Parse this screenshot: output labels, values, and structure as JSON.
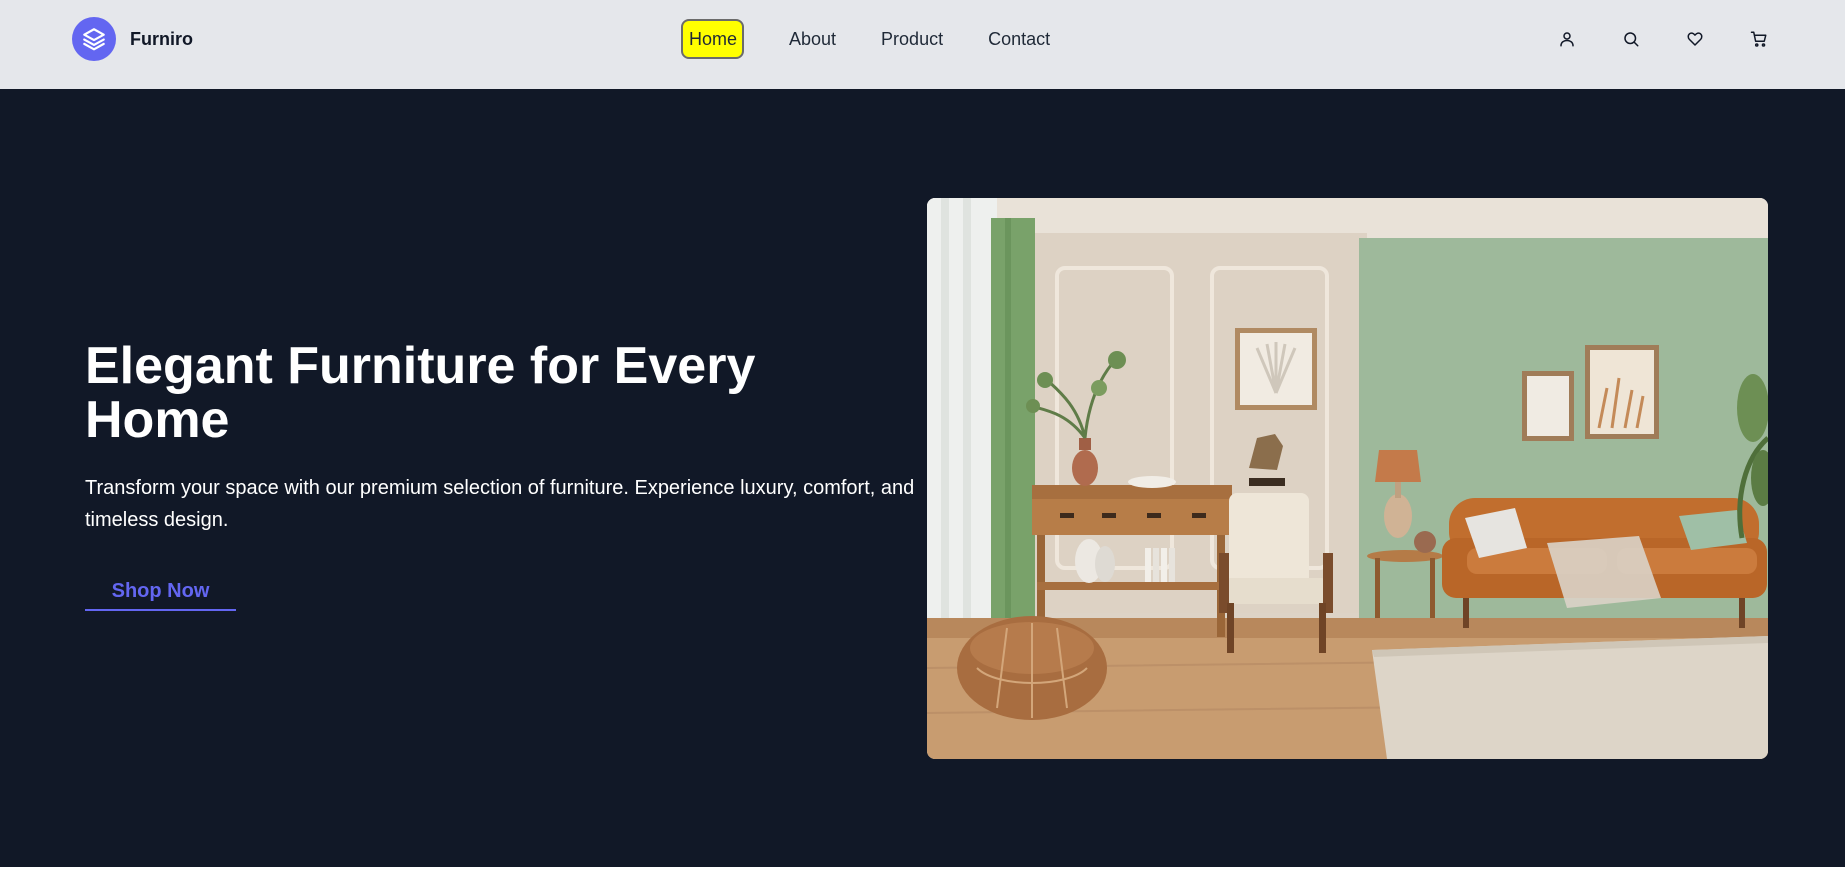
{
  "brand": {
    "name": "Furniro",
    "logo_icon": "layers-icon",
    "accent": "#6366f1"
  },
  "nav": {
    "items": [
      {
        "label": "Home",
        "active": true
      },
      {
        "label": "About"
      },
      {
        "label": "Product"
      },
      {
        "label": "Contact"
      }
    ],
    "active_bg": "#ffff00"
  },
  "header_icons": [
    "user-icon",
    "search-icon",
    "heart-icon",
    "cart-icon"
  ],
  "hero": {
    "title": "Elegant Furniture for Every Home",
    "description": "Transform your space with our premium selection of furniture. Experience luxury, comfort, and timeless design.",
    "cta_label": "Shop Now",
    "background": "#111827",
    "image_subject": "living-room-photo"
  },
  "colors": {
    "header_bg": "#e5e7eb",
    "accent": "#6366f1",
    "hero_bg": "#111827"
  }
}
